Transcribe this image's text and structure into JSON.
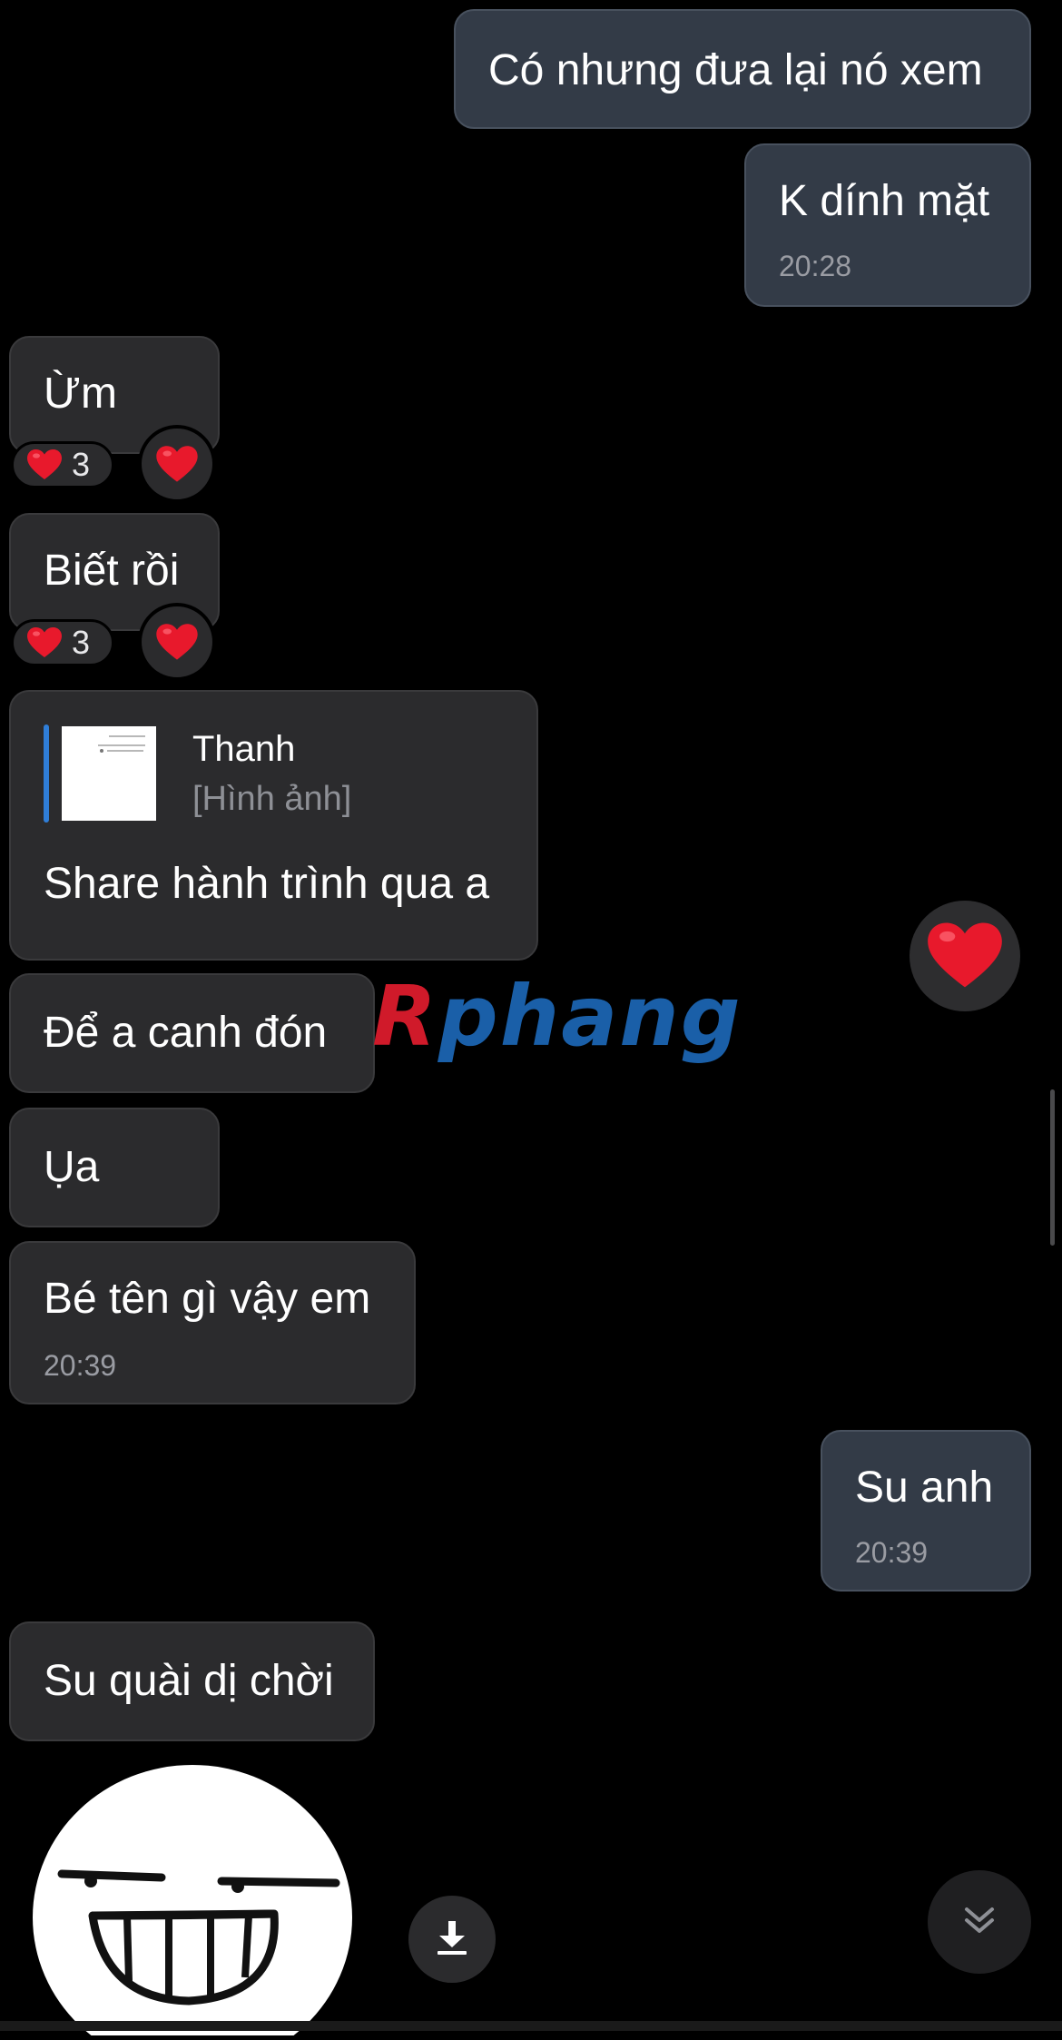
{
  "conversation": {
    "messages": [
      {
        "id": "m1",
        "direction": "outgoing",
        "text": "Có nhưng đưa lại nó xem"
      },
      {
        "id": "m2",
        "direction": "outgoing",
        "text": "K dính mặt",
        "time": "20:28"
      },
      {
        "id": "m3",
        "direction": "incoming",
        "text": "Ừm",
        "reaction": {
          "emoji": "heart",
          "count": "3"
        }
      },
      {
        "id": "m4",
        "direction": "incoming",
        "text": "Biết rồi",
        "reaction": {
          "emoji": "heart",
          "count": "3"
        }
      },
      {
        "id": "m5",
        "direction": "incoming",
        "text": "Share hành trình qua a",
        "reply_to": {
          "author": "Thanh",
          "preview": "[Hình ảnh]"
        }
      },
      {
        "id": "m6",
        "direction": "incoming",
        "text": "Để a canh đón"
      },
      {
        "id": "m7",
        "direction": "incoming",
        "text": "Ụa"
      },
      {
        "id": "m8",
        "direction": "incoming",
        "text": "Bé tên gì vậy em",
        "time": "20:39"
      },
      {
        "id": "m9",
        "direction": "outgoing",
        "text": "Su anh",
        "time": "20:39"
      },
      {
        "id": "m10",
        "direction": "incoming",
        "text": "Su quài dị chời"
      }
    ]
  },
  "watermark": {
    "first": "R",
    "rest": "phang"
  },
  "icons": {
    "reaction": "heart-icon",
    "floating_reaction": "heart-icon",
    "download": "download-icon",
    "scroll_down": "double-chevron-down-icon",
    "sticker": "grinning-face-sticker"
  },
  "colors": {
    "background": "#000000",
    "incoming_bubble": "#2b2b2d",
    "outgoing_bubble": "#333b47",
    "heart": "#e8192c",
    "quote_bar": "#2f7ed8",
    "timestamp": "#9a9ca3"
  }
}
